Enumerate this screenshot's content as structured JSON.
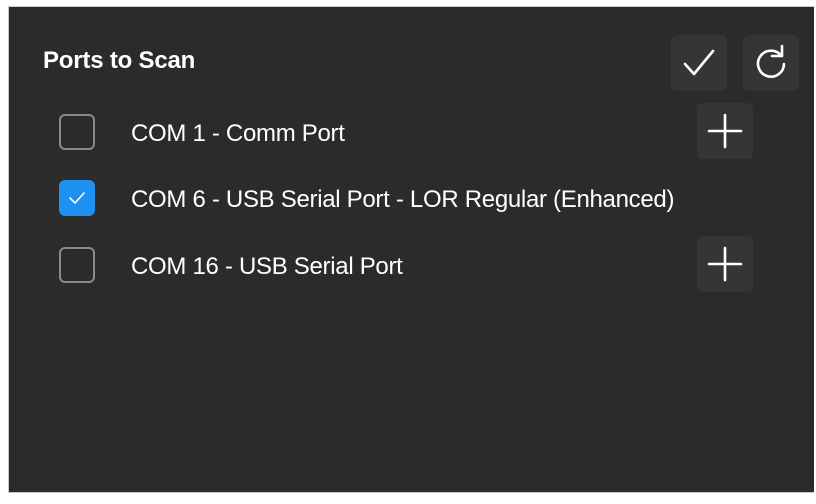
{
  "panel": {
    "title": "Ports to Scan"
  },
  "actions": [
    {
      "icon": "checkmark-icon"
    },
    {
      "icon": "refresh-icon"
    }
  ],
  "ports": [
    {
      "label": "COM 1 - Comm Port",
      "checked": false,
      "has_add": true
    },
    {
      "label": "COM 6 - USB Serial Port - LOR Regular (Enhanced)",
      "checked": true,
      "has_add": false
    },
    {
      "label": "COM 16 - USB Serial Port",
      "checked": false,
      "has_add": true
    }
  ],
  "colors": {
    "panel_bg": "#2b2b2b",
    "button_bg": "#353535",
    "check_accent": "#1e90f0",
    "text": "#ffffff"
  }
}
